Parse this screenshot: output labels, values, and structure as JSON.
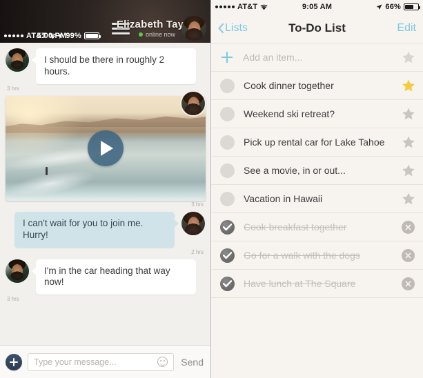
{
  "left_panel": {
    "status_bar": {
      "signal_dots": 5,
      "carrier": "AT&T",
      "wifi_icon": "wifi-icon",
      "time": "5:00 PM",
      "location_icon": "location-arrow-icon",
      "battery_percent": "99%",
      "battery_fill": 99
    },
    "header": {
      "menu_icon": "hamburger-menu-icon",
      "contact_name": "Elizabeth Taylor",
      "status_text": "online now",
      "status_color": "#5cc949",
      "avatar": "contact-avatar"
    },
    "messages": [
      {
        "type": "text",
        "direction": "in",
        "text": "I should be there in roughly 2 hours.",
        "timestamp": "3 hrs",
        "avatar": "sender-avatar-male"
      },
      {
        "type": "media",
        "direction": "out",
        "media_kind": "video",
        "play_icon": "play-button-icon",
        "timestamp": "3 hrs",
        "avatar": "sender-avatar-female"
      },
      {
        "type": "text",
        "direction": "out",
        "text": "I can't wait for you to join me. Hurry!",
        "timestamp": "2 hrs",
        "avatar": "sender-avatar-female"
      },
      {
        "type": "text",
        "direction": "in",
        "text": "I'm in the car heading that way now!",
        "timestamp": "3 hrs",
        "avatar": "sender-avatar-male"
      }
    ],
    "input_bar": {
      "attach_icon": "plus-attachment-icon",
      "placeholder": "Type your message...",
      "value": "",
      "emoji_icon": "smiley-emoji-icon",
      "send_label": "Send"
    },
    "colors": {
      "incoming_bubble": "#ffffff",
      "outgoing_bubble": "#cfe3e9",
      "background": "#f2f0ec",
      "accent_plus": "#2b3b52"
    }
  },
  "right_panel": {
    "status_bar": {
      "signal_dots": 5,
      "carrier": "AT&T",
      "wifi_icon": "wifi-icon",
      "time": "9:05 AM",
      "location_icon": "location-arrow-icon",
      "battery_percent": "66%",
      "battery_fill": 66
    },
    "nav": {
      "back_icon": "chevron-left-icon",
      "back_label": "Lists",
      "title": "To-Do List",
      "edit_label": "Edit"
    },
    "add_row": {
      "icon": "plus-icon",
      "placeholder": "Add an item...",
      "star": "star-outline-icon"
    },
    "items": [
      {
        "text": "Cook dinner together",
        "done": false,
        "starred": true
      },
      {
        "text": "Weekend ski retreat?",
        "done": false,
        "starred": false
      },
      {
        "text": "Pick up rental car for Lake Tahoe",
        "done": false,
        "starred": false
      },
      {
        "text": "See a movie, in or out...",
        "done": false,
        "starred": false
      },
      {
        "text": "Vacation in Hawaii",
        "done": false,
        "starred": false
      },
      {
        "text": "Cook breakfast together",
        "done": true,
        "starred": false
      },
      {
        "text": "Go for a walk with the dogs",
        "done": true,
        "starred": false
      },
      {
        "text": "Have lunch at The Square",
        "done": true,
        "starred": false
      }
    ],
    "colors": {
      "background": "#f7f4ef",
      "tint": "#7ec8e3",
      "star_active": "#f5cc3d",
      "star_inactive": "#c9c5bf",
      "separator": "#e7e2da"
    }
  }
}
